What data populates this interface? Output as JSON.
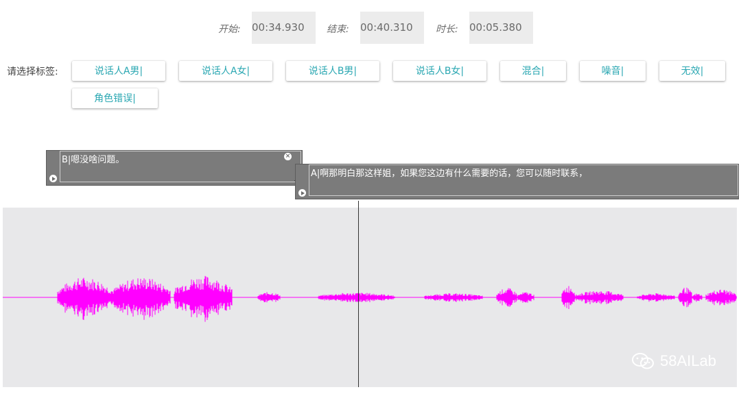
{
  "time": {
    "start_label": "开始:",
    "start_value": "00:34.930",
    "end_label": "结束:",
    "end_value": "00:40.310",
    "duration_label": "时长:",
    "duration_value": "00:05.380"
  },
  "tags": {
    "label": "请选择标签:",
    "buttons": [
      "说话人A男|",
      "说话人A女|",
      "说话人B男|",
      "说话人B女|",
      "混合|",
      "噪音|",
      "无效|",
      "角色错误|"
    ]
  },
  "segments": [
    {
      "text": "B|嗯没啥问题。"
    },
    {
      "text": "A|啊那明白那这样姐，如果您这边有什么需要的话，您可以随时联系，"
    }
  ],
  "waveform": {
    "color": "#ff00ff",
    "background": "#e8e8ea"
  },
  "watermark": {
    "text": "58AILab",
    "icon": "wechat-icon"
  }
}
